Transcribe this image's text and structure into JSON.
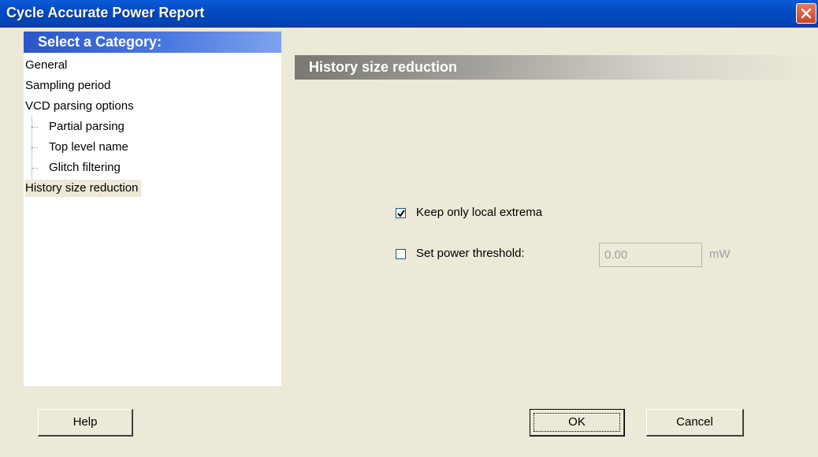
{
  "window": {
    "title": "Cycle Accurate Power Report"
  },
  "categories": {
    "header": "Select a Category:",
    "items": [
      {
        "label": "General"
      },
      {
        "label": "Sampling period"
      },
      {
        "label": "VCD parsing options"
      },
      {
        "label": "Partial parsing"
      },
      {
        "label": "Top level name"
      },
      {
        "label": "Glitch filtering"
      },
      {
        "label": "History size reduction"
      }
    ],
    "selected": "History size reduction"
  },
  "section": {
    "title": "History size reduction",
    "keep_local_extrema": {
      "label": "Keep only local extrema",
      "checked": true
    },
    "power_threshold": {
      "label": "Set power threshold:",
      "checked": false,
      "value": "0.00",
      "unit": "mW",
      "enabled": false
    }
  },
  "buttons": {
    "help": "Help",
    "ok": "OK",
    "cancel": "Cancel"
  },
  "icons": {
    "close": "close-icon",
    "check": "checkmark-icon"
  },
  "colors": {
    "title_bar": "#0049c0",
    "category_header": "#2c56c8",
    "close_button": "#c9452a",
    "dialog_bg": "#ece9d8"
  }
}
